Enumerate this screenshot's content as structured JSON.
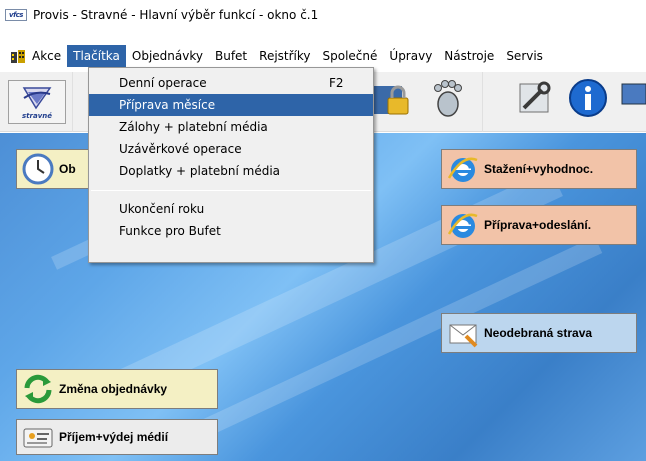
{
  "window": {
    "title": "Provis - Stravné - Hlavní výběr funkcí - okno č.1",
    "logo_text": "vfcs"
  },
  "menubar": {
    "items": [
      "Akce",
      "Tlačítka",
      "Objednávky",
      "Bufet",
      "Rejstříky",
      "Společné",
      "Úpravy",
      "Nástroje",
      "Servis"
    ],
    "active": "Tlačítka"
  },
  "toolbar": {
    "first_button_caption": "stravné"
  },
  "dropdown": {
    "items": [
      {
        "label": "Denní operace",
        "shortcut": "F2"
      },
      {
        "label": "Příprava měsíce",
        "shortcut": ""
      },
      {
        "label": "Zálohy + platební média",
        "shortcut": ""
      },
      {
        "label": "Uzávěrkové operace",
        "shortcut": ""
      },
      {
        "label": "Doplatky + platební média",
        "shortcut": ""
      },
      {
        "label": "Ukončení roku",
        "shortcut": ""
      },
      {
        "label": "Funkce pro Bufet",
        "shortcut": ""
      }
    ],
    "highlighted": "Příprava měsíce"
  },
  "panels": {
    "left_top_label": "Ob",
    "stazeni": "Stažení+vyhodnoc.",
    "priprava": "Příprava+odeslání.",
    "neodebrana": "Neodebraná strava",
    "zmena": "Změna objednávky",
    "prijem": "Příjem+výdej médií"
  },
  "colors": {
    "menu_highlight": "#2e64a8",
    "panel_pink": "#f2c3a8",
    "panel_blue": "#bcd6ee",
    "panel_yellow": "#f4f0c4",
    "desktop_blue": "#4d8fd6"
  }
}
